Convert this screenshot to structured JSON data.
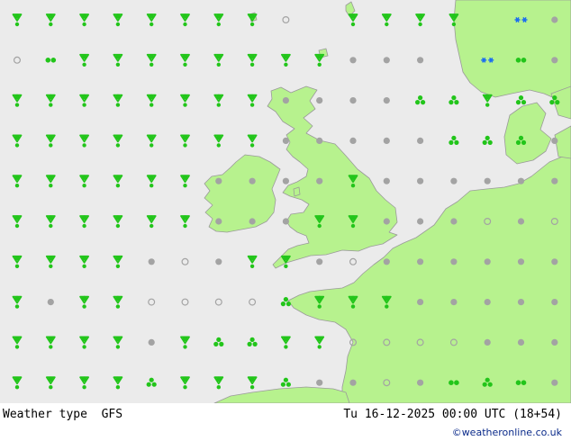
{
  "footer": {
    "title": "Weather type  GFS",
    "datetime": "Tu 16-12-2025 00:00 UTC (18+54)",
    "credit": "©weatheronline.co.uk"
  },
  "colors": {
    "sea": "#ebebeb",
    "land": "#b7f28e",
    "coast": "#9a9a9a",
    "rain": "#22c51a",
    "overcast": "#a3a3a3",
    "snow": "#1a6cf0"
  },
  "symbols": {
    "columns": 17,
    "rows": 10,
    "legend_codes": {
      "R": "showers-icon",
      "T": "rain-drops-icon",
      "D": "drizzle-icon",
      "G": "overcast-icon",
      "O": "cloudy-icon",
      "S": "snow-icon"
    },
    "grid": [
      "RRRRRRRRO.RRRR.SG",
      "OTRRRRRRRRGGG.STG",
      "RRRRRRRRGGGGDDRDD",
      "RRRRRRRRGGGGGDDDG",
      "RRRRRRGGGGRGGGGGG",
      "RRRRRRGGGRRGGGOGO",
      "RRRRGOGRRGOGGGGGG",
      "RGRROOOODRRRGGGGG",
      "RRRRGRDDRROOOOGGG",
      "RRRRDRRRDGGOGTDTG"
    ]
  }
}
